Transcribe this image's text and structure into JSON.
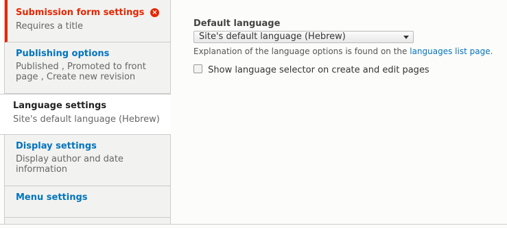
{
  "sidebar": {
    "tabs": [
      {
        "title": "Submission form settings",
        "summary": "Requires a title"
      },
      {
        "title": "Publishing options",
        "summary_lines": [
          "Published , Promoted to front",
          "page , Create new revision"
        ]
      },
      {
        "title": "Language settings",
        "summary": "Site's default language (Hebrew)"
      },
      {
        "title": "Display settings",
        "summary_lines": [
          "Display author and date",
          "information"
        ]
      },
      {
        "title": "Menu settings"
      }
    ],
    "error_icon": "error-icon"
  },
  "language": {
    "field_label": "Default language",
    "selected": "Site's default language (Hebrew)",
    "description": "Explanation of the language options is found on the",
    "description_link": "languages list page",
    "description_end": ".",
    "checkbox_label": "Show language selector on create and edit pages"
  },
  "colors": {
    "accent": "#0074bd",
    "error": "#e62600"
  }
}
